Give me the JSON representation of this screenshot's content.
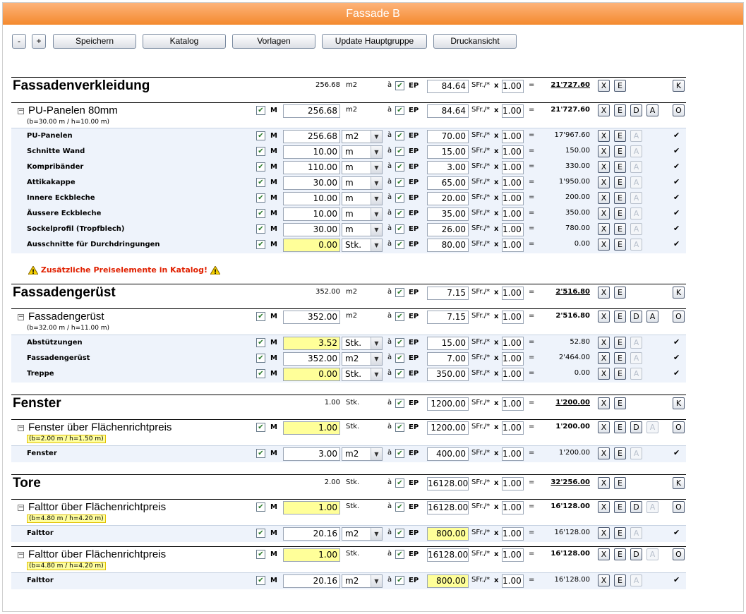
{
  "title": "Fassade B",
  "toolbar": {
    "minus": "-",
    "plus": "+",
    "speichern": "Speichern",
    "katalog": "Katalog",
    "vorlagen": "Vorlagen",
    "update": "Update Hauptgruppe",
    "druck": "Druckansicht"
  },
  "common": {
    "m": "M",
    "a": "à",
    "ep": "EP",
    "sfr": "SFr./*",
    "x": "x",
    "eq": "=",
    "check": "✔",
    "toggle": "−",
    "cbmark": "✔",
    "btnX": "X",
    "btnE": "E",
    "btnD": "D",
    "btnA": "A",
    "btnK": "K",
    "btnO": "O",
    "dd": "▼"
  },
  "warning": "Zusätzliche Preiselemente in Katalog!",
  "warnIcon": "warning-triangle-icon",
  "groups": [
    {
      "name": "Fassadenverkleidung",
      "qty": "256.68",
      "unit": "m2",
      "ep": "84.64",
      "factor": "1.00",
      "total": "21'727.60",
      "sections": [
        {
          "name": "PU-Panelen 80mm",
          "dims": "(b=30.00 m / h=10.00 m)",
          "qty": "256.68",
          "qtyHl": false,
          "unit": "m2",
          "ep": "84.64",
          "factor": "1.00",
          "total": "21'727.60",
          "items": [
            {
              "name": "PU-Panelen",
              "qty": "256.68",
              "unit": "m2",
              "ep": "70.00",
              "factor": "1.00",
              "total": "17'967.60"
            },
            {
              "name": "Schnitte Wand",
              "qty": "10.00",
              "unit": "m",
              "ep": "15.00",
              "factor": "1.00",
              "total": "150.00"
            },
            {
              "name": "Kompribänder",
              "qty": "110.00",
              "unit": "m",
              "ep": "3.00",
              "factor": "1.00",
              "total": "330.00"
            },
            {
              "name": "Attikakappe",
              "qty": "30.00",
              "unit": "m",
              "ep": "65.00",
              "factor": "1.00",
              "total": "1'950.00"
            },
            {
              "name": "Innere Eckbleche",
              "qty": "10.00",
              "unit": "m",
              "ep": "20.00",
              "factor": "1.00",
              "total": "200.00"
            },
            {
              "name": "Äussere Eckbleche",
              "qty": "10.00",
              "unit": "m",
              "ep": "35.00",
              "factor": "1.00",
              "total": "350.00"
            },
            {
              "name": "Sockelprofil (Tropfblech)",
              "qty": "30.00",
              "unit": "m",
              "ep": "26.00",
              "factor": "1.00",
              "total": "780.00"
            },
            {
              "name": "Ausschnitte für Durchdringungen",
              "qty": "0.00",
              "qtyHl": true,
              "unit": "Stk.",
              "ep": "80.00",
              "factor": "1.00",
              "total": "0.00"
            }
          ]
        }
      ]
    },
    {
      "name": "Fassadengerüst",
      "qty": "352.00",
      "unit": "m2",
      "ep": "7.15",
      "factor": "1.00",
      "total": "2'516.80",
      "sections": [
        {
          "name": "Fassadengerüst",
          "dims": "(b=32.00 m / h=11.00 m)",
          "qty": "352.00",
          "unit": "m2",
          "ep": "7.15",
          "factor": "1.00",
          "total": "2'516.80",
          "items": [
            {
              "name": "Abstützungen",
              "qty": "3.52",
              "qtyHl": true,
              "unit": "Stk.",
              "ep": "15.00",
              "factor": "1.00",
              "total": "52.80"
            },
            {
              "name": "Fassadengerüst",
              "qty": "352.00",
              "unit": "m2",
              "ep": "7.00",
              "factor": "1.00",
              "total": "2'464.00"
            },
            {
              "name": "Treppe",
              "qty": "0.00",
              "qtyHl": true,
              "unit": "Stk.",
              "ep": "350.00",
              "factor": "1.00",
              "total": "0.00"
            }
          ]
        }
      ]
    },
    {
      "name": "Fenster",
      "qty": "1.00",
      "unit": "Stk.",
      "ep": "1200.00",
      "factor": "1.00",
      "total": "1'200.00",
      "sections": [
        {
          "name": "Fenster über Flächenrichtpreis",
          "dims": "(b=2.00 m / h=1.50 m)",
          "qty": "1.00",
          "qtyHl": true,
          "unit": "Stk.",
          "ep": "1200.00",
          "factor": "1.00",
          "total": "1'200.00",
          "items": [
            {
              "name": "Fenster",
              "qty": "3.00",
              "unit": "m2",
              "ep": "400.00",
              "factor": "1.00",
              "total": "1'200.00"
            }
          ]
        }
      ]
    },
    {
      "name": "Tore",
      "qty": "2.00",
      "unit": "Stk.",
      "ep": "16128.00",
      "factor": "1.00",
      "total": "32'256.00",
      "sections": [
        {
          "name": "Falttor über Flächenrichtpreis",
          "dims": "(b=4.80 m / h=4.20 m)",
          "qty": "1.00",
          "qtyHl": true,
          "unit": "Stk.",
          "ep": "16128.00",
          "factor": "1.00",
          "total": "16'128.00",
          "items": [
            {
              "name": "Falttor",
              "qty": "20.16",
              "unit": "m2",
              "ep": "800.00",
              "epHl": true,
              "factor": "1.00",
              "total": "16'128.00"
            }
          ]
        },
        {
          "name": "Falttor über Flächenrichtpreis",
          "dims": "(b=4.80 m / h=4.20 m)",
          "qty": "1.00",
          "qtyHl": true,
          "unit": "Stk.",
          "ep": "16128.00",
          "factor": "1.00",
          "total": "16'128.00",
          "items": [
            {
              "name": "Falttor",
              "qty": "20.16",
              "unit": "m2",
              "ep": "800.00",
              "epHl": true,
              "factor": "1.00",
              "total": "16'128.00"
            }
          ]
        }
      ]
    }
  ]
}
